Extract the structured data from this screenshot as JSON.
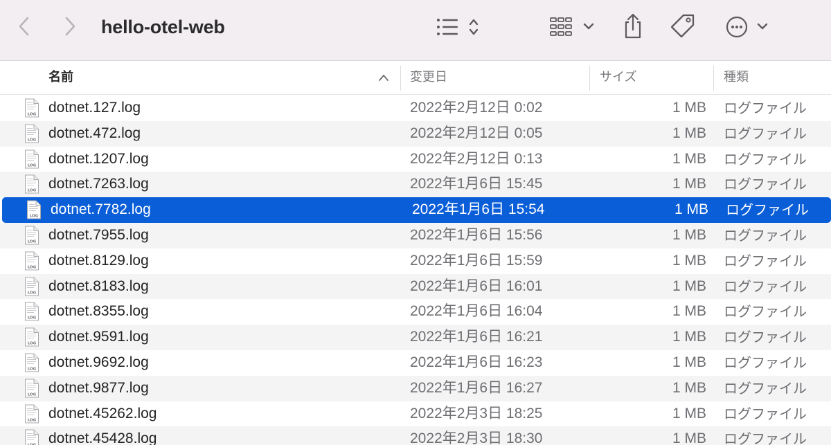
{
  "window": {
    "title": "hello-otel-web"
  },
  "columns": {
    "name": "名前",
    "date": "変更日",
    "size": "サイズ",
    "kind": "種類"
  },
  "icons": {
    "back": "chevron-left-icon",
    "forward": "chevron-right-icon",
    "list_view": "list-icon",
    "grid_view": "grid-icon",
    "share": "share-icon",
    "tag": "tag-icon",
    "more": "ellipsis-circle-icon",
    "file": "log-file-icon"
  },
  "colors": {
    "selection": "#0a5ed8",
    "toolbar": "#f3eef2"
  },
  "file_icon_label": "LOG",
  "files": [
    {
      "name": "dotnet.127.log",
      "date": "2022年2月12日 0:02",
      "size": "1 MB",
      "kind": "ログファイル"
    },
    {
      "name": "dotnet.472.log",
      "date": "2022年2月12日 0:05",
      "size": "1 MB",
      "kind": "ログファイル"
    },
    {
      "name": "dotnet.1207.log",
      "date": "2022年2月12日 0:13",
      "size": "1 MB",
      "kind": "ログファイル"
    },
    {
      "name": "dotnet.7263.log",
      "date": "2022年1月6日 15:45",
      "size": "1 MB",
      "kind": "ログファイル"
    },
    {
      "name": "dotnet.7782.log",
      "date": "2022年1月6日 15:54",
      "size": "1 MB",
      "kind": "ログファイル",
      "selected": true
    },
    {
      "name": "dotnet.7955.log",
      "date": "2022年1月6日 15:56",
      "size": "1 MB",
      "kind": "ログファイル"
    },
    {
      "name": "dotnet.8129.log",
      "date": "2022年1月6日 15:59",
      "size": "1 MB",
      "kind": "ログファイル"
    },
    {
      "name": "dotnet.8183.log",
      "date": "2022年1月6日 16:01",
      "size": "1 MB",
      "kind": "ログファイル"
    },
    {
      "name": "dotnet.8355.log",
      "date": "2022年1月6日 16:04",
      "size": "1 MB",
      "kind": "ログファイル"
    },
    {
      "name": "dotnet.9591.log",
      "date": "2022年1月6日 16:21",
      "size": "1 MB",
      "kind": "ログファイル"
    },
    {
      "name": "dotnet.9692.log",
      "date": "2022年1月6日 16:23",
      "size": "1 MB",
      "kind": "ログファイル"
    },
    {
      "name": "dotnet.9877.log",
      "date": "2022年1月6日 16:27",
      "size": "1 MB",
      "kind": "ログファイル"
    },
    {
      "name": "dotnet.45262.log",
      "date": "2022年2月3日 18:25",
      "size": "1 MB",
      "kind": "ログファイル"
    },
    {
      "name": "dotnet.45428.log",
      "date": "2022年2月3日 18:30",
      "size": "1 MB",
      "kind": "ログファイル"
    }
  ]
}
